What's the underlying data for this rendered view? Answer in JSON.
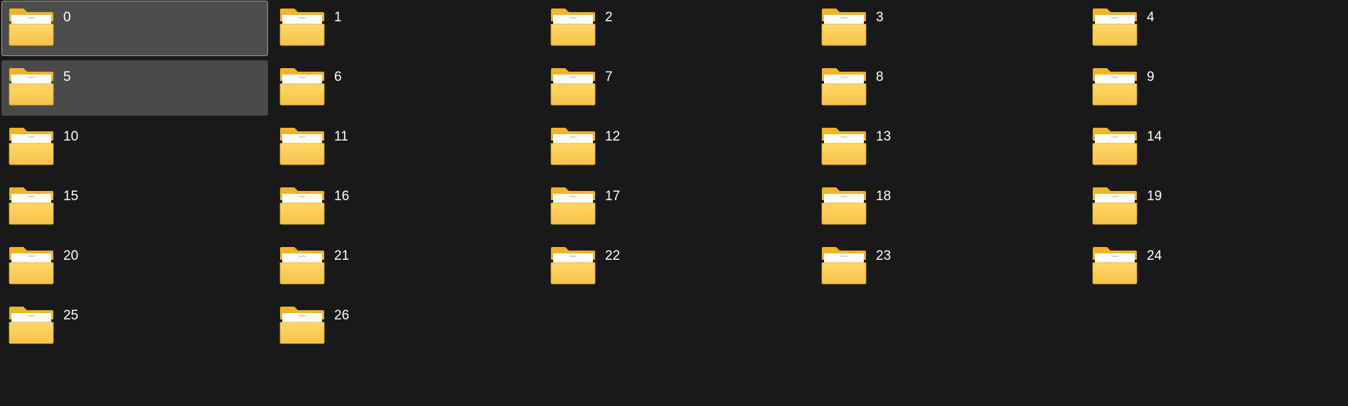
{
  "window": {
    "view_mode": "large icons",
    "selected_item": "0",
    "hovered_item": "5"
  },
  "colors": {
    "background": "#191919",
    "selection_bg": "#4d4d4d",
    "selection_border": "#9a9a9a",
    "folder_back": "#f0b429",
    "folder_front_top": "#ffd86a",
    "folder_front_bottom": "#f5c24a",
    "paper": "#ffffff",
    "label_text": "#ffffff"
  },
  "folders": [
    {
      "name": "0",
      "icon": "folder-with-chart-preview-icon",
      "state": "selected"
    },
    {
      "name": "1",
      "icon": "folder-with-chart-preview-icon",
      "state": "normal"
    },
    {
      "name": "2",
      "icon": "folder-with-chart-preview-icon",
      "state": "normal"
    },
    {
      "name": "3",
      "icon": "folder-with-chart-preview-icon",
      "state": "normal"
    },
    {
      "name": "4",
      "icon": "folder-with-chart-preview-icon",
      "state": "normal"
    },
    {
      "name": "5",
      "icon": "folder-with-chart-preview-icon",
      "state": "hover"
    },
    {
      "name": "6",
      "icon": "folder-with-chart-preview-icon",
      "state": "normal"
    },
    {
      "name": "7",
      "icon": "folder-with-chart-preview-icon",
      "state": "normal"
    },
    {
      "name": "8",
      "icon": "folder-with-chart-preview-icon",
      "state": "normal"
    },
    {
      "name": "9",
      "icon": "folder-with-chart-preview-icon",
      "state": "normal"
    },
    {
      "name": "10",
      "icon": "folder-with-chart-preview-icon",
      "state": "normal"
    },
    {
      "name": "11",
      "icon": "folder-with-chart-preview-icon",
      "state": "normal"
    },
    {
      "name": "12",
      "icon": "folder-with-chart-preview-icon",
      "state": "normal"
    },
    {
      "name": "13",
      "icon": "folder-with-chart-preview-icon",
      "state": "normal"
    },
    {
      "name": "14",
      "icon": "folder-with-chart-preview-icon",
      "state": "normal"
    },
    {
      "name": "15",
      "icon": "folder-with-chart-preview-icon",
      "state": "normal"
    },
    {
      "name": "16",
      "icon": "folder-with-chart-preview-icon",
      "state": "normal"
    },
    {
      "name": "17",
      "icon": "folder-with-chart-preview-icon",
      "state": "normal"
    },
    {
      "name": "18",
      "icon": "folder-with-chart-preview-icon",
      "state": "normal"
    },
    {
      "name": "19",
      "icon": "folder-with-chart-preview-icon",
      "state": "normal"
    },
    {
      "name": "20",
      "icon": "folder-with-chart-preview-icon",
      "state": "normal"
    },
    {
      "name": "21",
      "icon": "folder-with-chart-preview-icon",
      "state": "normal"
    },
    {
      "name": "22",
      "icon": "folder-with-chart-preview-icon",
      "state": "normal"
    },
    {
      "name": "23",
      "icon": "folder-with-chart-preview-icon",
      "state": "normal"
    },
    {
      "name": "24",
      "icon": "folder-with-chart-preview-icon",
      "state": "normal"
    },
    {
      "name": "25",
      "icon": "folder-with-chart-preview-icon",
      "state": "normal"
    },
    {
      "name": "26",
      "icon": "folder-with-chart-preview-icon",
      "state": "normal"
    }
  ]
}
